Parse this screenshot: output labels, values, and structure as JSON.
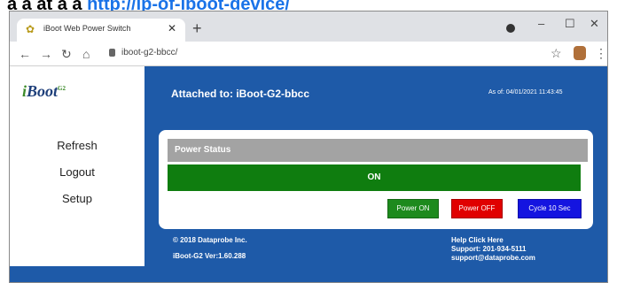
{
  "link_above": {
    "plain_text": "a a at a a",
    "link_text": "http://ip-of-iboot-device/"
  },
  "browser": {
    "tab_title": "iBoot Web Power Switch",
    "url": "iboot-g2-bbcc/",
    "icons": {
      "favicon": "iboot-favicon-icon",
      "tab_close": "close-icon",
      "new_tab": "plus-icon",
      "minimize": "minimize-icon",
      "maximize": "maximize-icon",
      "close_window": "close-icon",
      "back": "back-arrow-icon",
      "forward": "forward-arrow-icon",
      "reload": "reload-icon",
      "home": "home-icon",
      "lock": "lock-icon",
      "bookmark": "star-icon",
      "profile": "avatar-icon",
      "menu": "kebab-menu-icon"
    }
  },
  "sidebar": {
    "logo_text": "Boot",
    "logo_sup": "G2",
    "links": [
      "Refresh",
      "Logout",
      "Setup"
    ]
  },
  "header": {
    "attached_to": "Attached to: iBoot-G2-bbcc",
    "as_of": "As of: 04/01/2021 11:43:45"
  },
  "power_status": {
    "title": "Power Status",
    "state": "ON",
    "buttons": {
      "on": "Power ON",
      "off": "Power OFF",
      "cycle": "Cycle 10 Sec"
    }
  },
  "footer": {
    "copyright": "© 2018 Dataprobe Inc.",
    "version": "iBoot-G2 Ver:1.60.288",
    "help": "Help Click Here",
    "support_phone": "Support: 201-934-5111",
    "support_email": "support@dataprobe.com"
  },
  "colors": {
    "page_blue": "#1e5aa8",
    "on_green": "#0f7d0f",
    "off_red": "#e00000",
    "cycle_blue": "#1414e0",
    "header_gray": "#a3a3a3"
  }
}
